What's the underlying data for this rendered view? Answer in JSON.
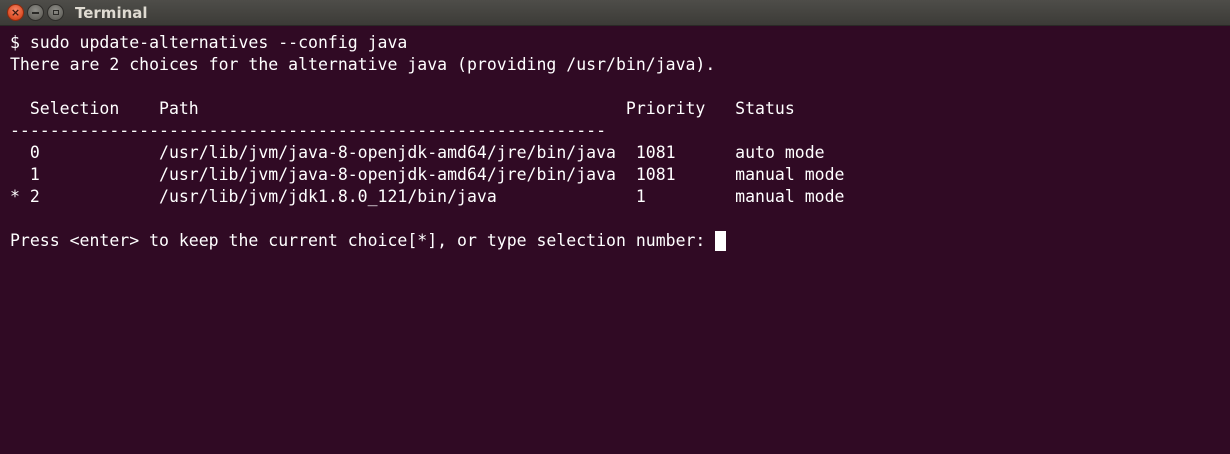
{
  "window": {
    "title": "Terminal",
    "close_glyph": "×",
    "background": "#300a24",
    "text_color": "#ffffff"
  },
  "icons": {
    "close": "close-icon",
    "minimize": "minimize-icon",
    "maximize": "maximize-icon"
  },
  "terminal": {
    "lines": [
      "$ sudo update-alternatives --config java",
      "There are 2 choices for the alternative java (providing /usr/bin/java).",
      "",
      "  Selection    Path                                           Priority   Status",
      "------------------------------------------------------------",
      "  0            /usr/lib/jvm/java-8-openjdk-amd64/jre/bin/java  1081      auto mode",
      "  1            /usr/lib/jvm/java-8-openjdk-amd64/jre/bin/java  1081      manual mode",
      "* 2            /usr/lib/jvm/jdk1.8.0_121/bin/java              1         manual mode",
      "",
      "Press <enter> to keep the current choice[*], or type selection number: "
    ]
  }
}
